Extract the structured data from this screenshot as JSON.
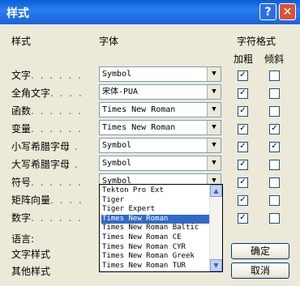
{
  "window": {
    "title": "样式",
    "help_label": "?",
    "close_label": "✕"
  },
  "header": {
    "style": "样式",
    "font": "字体",
    "char_format": "字符格式",
    "bold": "加粗",
    "italic": "倾斜"
  },
  "rows": [
    {
      "label": "文字",
      "dots": ". . . . . .",
      "font": "Symbol",
      "bold": true,
      "italic": false
    },
    {
      "label": "全角文字",
      "dots": ". . . .",
      "font": "宋体-PUA",
      "bold": true,
      "italic": false
    },
    {
      "label": "函数",
      "dots": ". . . . . .",
      "font": "Times New Roman",
      "bold": true,
      "italic": false
    },
    {
      "label": "变量",
      "dots": ". . . . . .",
      "font": "Times New Roman",
      "bold": true,
      "italic": true
    },
    {
      "label": "小写希腊字母",
      "dots": " .",
      "font": "Symbol",
      "bold": true,
      "italic": true
    },
    {
      "label": "大写希腊字母",
      "dots": " .",
      "font": "Symbol",
      "bold": true,
      "italic": false
    },
    {
      "label": "符号",
      "dots": ". . . . . .",
      "font": "Symbol",
      "bold": true,
      "italic": false
    },
    {
      "label": "矩阵向量",
      "dots": ". . . .",
      "font": "",
      "bold": true,
      "italic": false
    },
    {
      "label": "数字",
      "dots": ". . . . . .",
      "font": "",
      "bold": true,
      "italic": false
    }
  ],
  "dropdown": {
    "options": [
      "Tekton Pro Ext",
      "Tiger",
      "Tiger Expert",
      "Times New Roman",
      "Times New Roman Baltic",
      "Times New Roman CE",
      "Times New Roman CYR",
      "Times New Roman Greek",
      "Times New Roman TUR"
    ],
    "selected_index": 3
  },
  "language": {
    "label": "语言:",
    "text_style": "文字样式",
    "other_style": "其他样式"
  },
  "buttons": {
    "ok": "确定",
    "cancel": "取消"
  }
}
